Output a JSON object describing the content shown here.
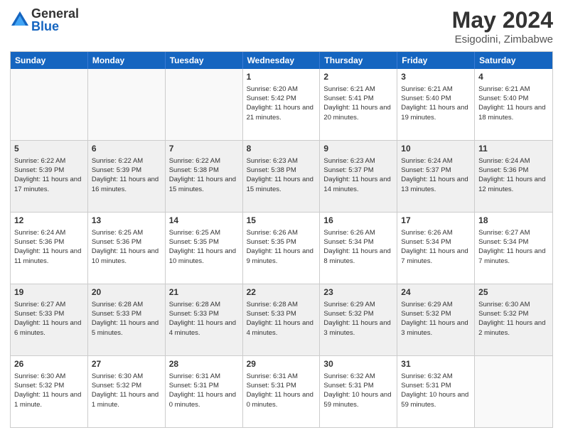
{
  "header": {
    "logo_general": "General",
    "logo_blue": "Blue",
    "month_year": "May 2024",
    "location": "Esigodini, Zimbabwe"
  },
  "day_names": [
    "Sunday",
    "Monday",
    "Tuesday",
    "Wednesday",
    "Thursday",
    "Friday",
    "Saturday"
  ],
  "rows": [
    [
      {
        "date": "",
        "empty": true
      },
      {
        "date": "",
        "empty": true
      },
      {
        "date": "",
        "empty": true
      },
      {
        "date": "1",
        "sunrise": "Sunrise: 6:20 AM",
        "sunset": "Sunset: 5:42 PM",
        "daylight": "Daylight: 11 hours and 21 minutes.",
        "shaded": false
      },
      {
        "date": "2",
        "sunrise": "Sunrise: 6:21 AM",
        "sunset": "Sunset: 5:41 PM",
        "daylight": "Daylight: 11 hours and 20 minutes.",
        "shaded": false
      },
      {
        "date": "3",
        "sunrise": "Sunrise: 6:21 AM",
        "sunset": "Sunset: 5:40 PM",
        "daylight": "Daylight: 11 hours and 19 minutes.",
        "shaded": false
      },
      {
        "date": "4",
        "sunrise": "Sunrise: 6:21 AM",
        "sunset": "Sunset: 5:40 PM",
        "daylight": "Daylight: 11 hours and 18 minutes.",
        "shaded": false
      }
    ],
    [
      {
        "date": "5",
        "sunrise": "Sunrise: 6:22 AM",
        "sunset": "Sunset: 5:39 PM",
        "daylight": "Daylight: 11 hours and 17 minutes.",
        "shaded": true
      },
      {
        "date": "6",
        "sunrise": "Sunrise: 6:22 AM",
        "sunset": "Sunset: 5:39 PM",
        "daylight": "Daylight: 11 hours and 16 minutes.",
        "shaded": true
      },
      {
        "date": "7",
        "sunrise": "Sunrise: 6:22 AM",
        "sunset": "Sunset: 5:38 PM",
        "daylight": "Daylight: 11 hours and 15 minutes.",
        "shaded": true
      },
      {
        "date": "8",
        "sunrise": "Sunrise: 6:23 AM",
        "sunset": "Sunset: 5:38 PM",
        "daylight": "Daylight: 11 hours and 15 minutes.",
        "shaded": true
      },
      {
        "date": "9",
        "sunrise": "Sunrise: 6:23 AM",
        "sunset": "Sunset: 5:37 PM",
        "daylight": "Daylight: 11 hours and 14 minutes.",
        "shaded": true
      },
      {
        "date": "10",
        "sunrise": "Sunrise: 6:24 AM",
        "sunset": "Sunset: 5:37 PM",
        "daylight": "Daylight: 11 hours and 13 minutes.",
        "shaded": true
      },
      {
        "date": "11",
        "sunrise": "Sunrise: 6:24 AM",
        "sunset": "Sunset: 5:36 PM",
        "daylight": "Daylight: 11 hours and 12 minutes.",
        "shaded": true
      }
    ],
    [
      {
        "date": "12",
        "sunrise": "Sunrise: 6:24 AM",
        "sunset": "Sunset: 5:36 PM",
        "daylight": "Daylight: 11 hours and 11 minutes.",
        "shaded": false
      },
      {
        "date": "13",
        "sunrise": "Sunrise: 6:25 AM",
        "sunset": "Sunset: 5:36 PM",
        "daylight": "Daylight: 11 hours and 10 minutes.",
        "shaded": false
      },
      {
        "date": "14",
        "sunrise": "Sunrise: 6:25 AM",
        "sunset": "Sunset: 5:35 PM",
        "daylight": "Daylight: 11 hours and 10 minutes.",
        "shaded": false
      },
      {
        "date": "15",
        "sunrise": "Sunrise: 6:26 AM",
        "sunset": "Sunset: 5:35 PM",
        "daylight": "Daylight: 11 hours and 9 minutes.",
        "shaded": false
      },
      {
        "date": "16",
        "sunrise": "Sunrise: 6:26 AM",
        "sunset": "Sunset: 5:34 PM",
        "daylight": "Daylight: 11 hours and 8 minutes.",
        "shaded": false
      },
      {
        "date": "17",
        "sunrise": "Sunrise: 6:26 AM",
        "sunset": "Sunset: 5:34 PM",
        "daylight": "Daylight: 11 hours and 7 minutes.",
        "shaded": false
      },
      {
        "date": "18",
        "sunrise": "Sunrise: 6:27 AM",
        "sunset": "Sunset: 5:34 PM",
        "daylight": "Daylight: 11 hours and 7 minutes.",
        "shaded": false
      }
    ],
    [
      {
        "date": "19",
        "sunrise": "Sunrise: 6:27 AM",
        "sunset": "Sunset: 5:33 PM",
        "daylight": "Daylight: 11 hours and 6 minutes.",
        "shaded": true
      },
      {
        "date": "20",
        "sunrise": "Sunrise: 6:28 AM",
        "sunset": "Sunset: 5:33 PM",
        "daylight": "Daylight: 11 hours and 5 minutes.",
        "shaded": true
      },
      {
        "date": "21",
        "sunrise": "Sunrise: 6:28 AM",
        "sunset": "Sunset: 5:33 PM",
        "daylight": "Daylight: 11 hours and 4 minutes.",
        "shaded": true
      },
      {
        "date": "22",
        "sunrise": "Sunrise: 6:28 AM",
        "sunset": "Sunset: 5:33 PM",
        "daylight": "Daylight: 11 hours and 4 minutes.",
        "shaded": true
      },
      {
        "date": "23",
        "sunrise": "Sunrise: 6:29 AM",
        "sunset": "Sunset: 5:32 PM",
        "daylight": "Daylight: 11 hours and 3 minutes.",
        "shaded": true
      },
      {
        "date": "24",
        "sunrise": "Sunrise: 6:29 AM",
        "sunset": "Sunset: 5:32 PM",
        "daylight": "Daylight: 11 hours and 3 minutes.",
        "shaded": true
      },
      {
        "date": "25",
        "sunrise": "Sunrise: 6:30 AM",
        "sunset": "Sunset: 5:32 PM",
        "daylight": "Daylight: 11 hours and 2 minutes.",
        "shaded": true
      }
    ],
    [
      {
        "date": "26",
        "sunrise": "Sunrise: 6:30 AM",
        "sunset": "Sunset: 5:32 PM",
        "daylight": "Daylight: 11 hours and 1 minute.",
        "shaded": false
      },
      {
        "date": "27",
        "sunrise": "Sunrise: 6:30 AM",
        "sunset": "Sunset: 5:32 PM",
        "daylight": "Daylight: 11 hours and 1 minute.",
        "shaded": false
      },
      {
        "date": "28",
        "sunrise": "Sunrise: 6:31 AM",
        "sunset": "Sunset: 5:31 PM",
        "daylight": "Daylight: 11 hours and 0 minutes.",
        "shaded": false
      },
      {
        "date": "29",
        "sunrise": "Sunrise: 6:31 AM",
        "sunset": "Sunset: 5:31 PM",
        "daylight": "Daylight: 11 hours and 0 minutes.",
        "shaded": false
      },
      {
        "date": "30",
        "sunrise": "Sunrise: 6:32 AM",
        "sunset": "Sunset: 5:31 PM",
        "daylight": "Daylight: 10 hours and 59 minutes.",
        "shaded": false
      },
      {
        "date": "31",
        "sunrise": "Sunrise: 6:32 AM",
        "sunset": "Sunset: 5:31 PM",
        "daylight": "Daylight: 10 hours and 59 minutes.",
        "shaded": false
      },
      {
        "date": "",
        "empty": true
      }
    ]
  ]
}
